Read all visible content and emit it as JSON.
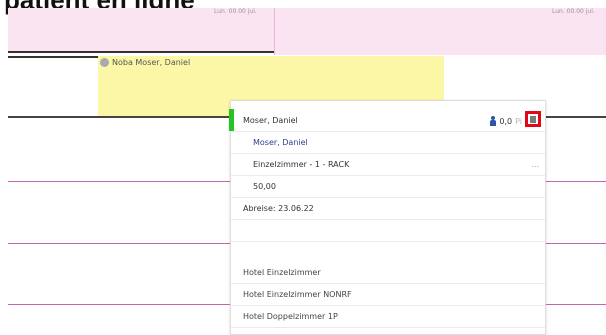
{
  "heading": "patient en ligne",
  "header_dates": [
    "Lun. 00.00 jui.",
    "Lun. 00.00 jui."
  ],
  "booking": {
    "label": "Noba Moser, Daniel"
  },
  "popup": {
    "guest_name": "Moser, Daniel",
    "persons": "0,0",
    "faded_text": "Pi",
    "name_link": "Moser, Daniel",
    "room": "Einzelzimmer - 1 - RACK",
    "price": "50,00",
    "departure": "Abreise: 23.06.22",
    "more_glyph": "...",
    "options": [
      "Hotel Einzelzimmer",
      "Hotel Einzelzimmer NONRF",
      "Hotel Doppelzimmer 1P"
    ]
  },
  "colors": {
    "accent": "#25c420",
    "highlight": "#e30613",
    "booking": "#fbf7a6",
    "grid_line": "#c566b4"
  }
}
